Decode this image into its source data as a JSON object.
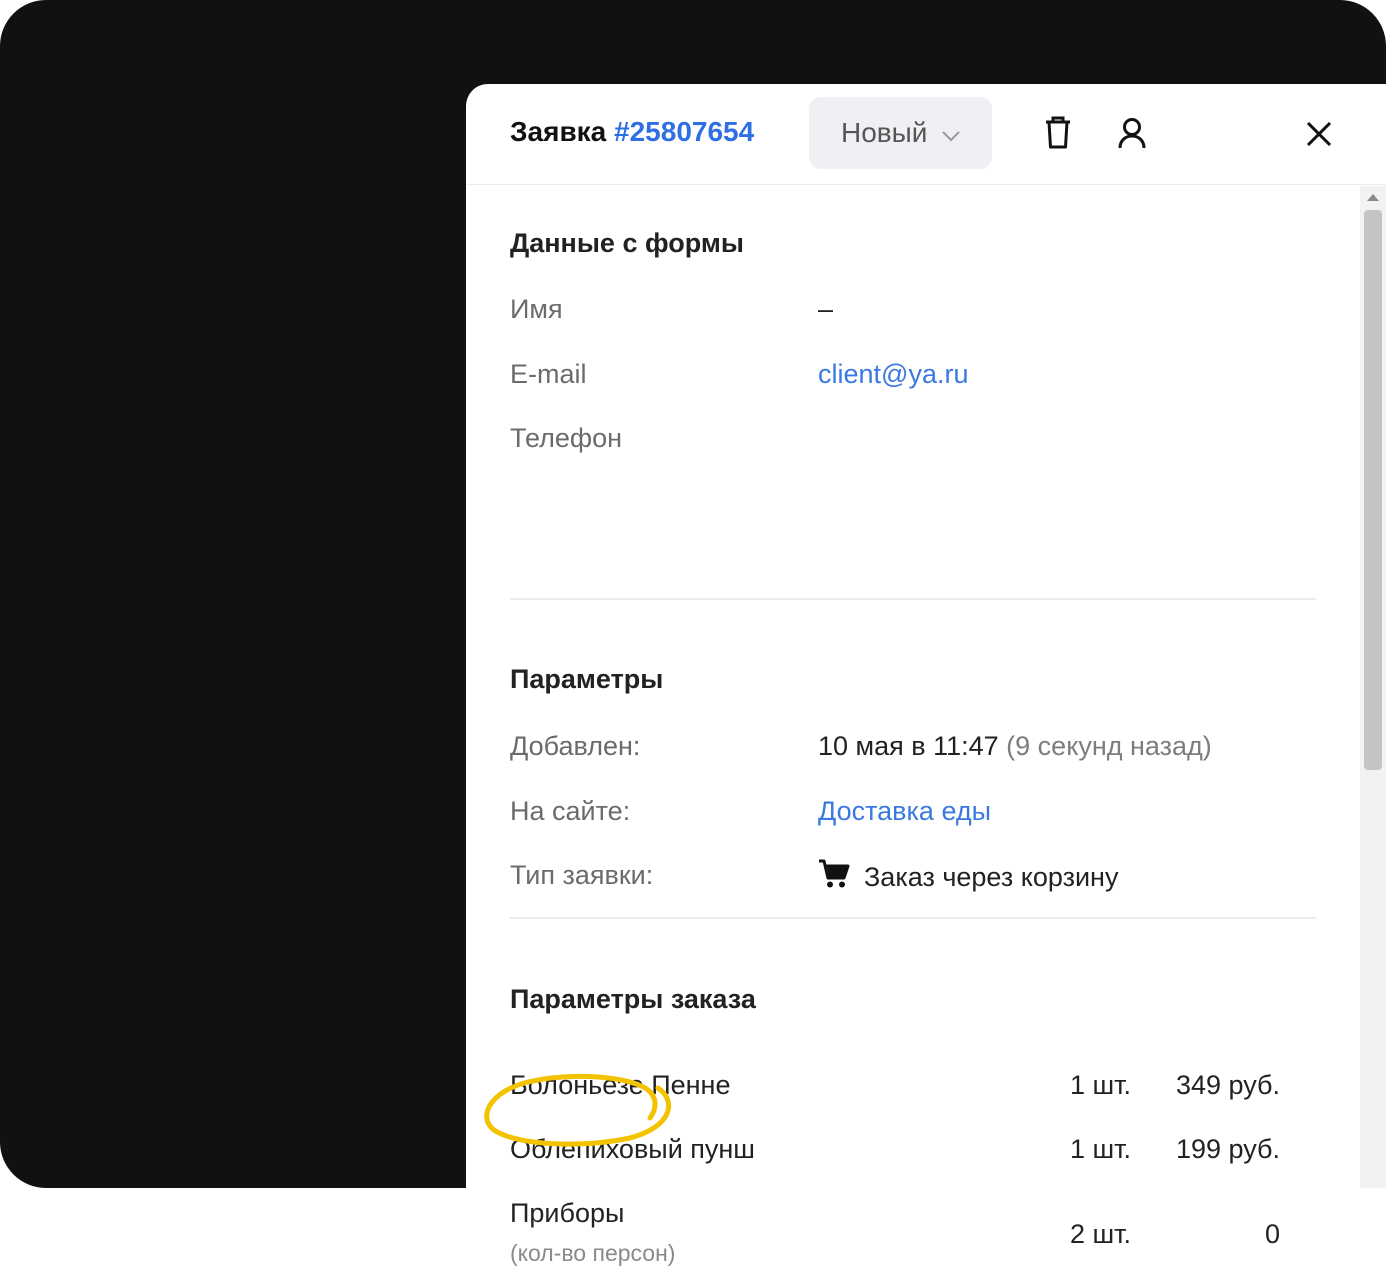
{
  "header": {
    "title_prefix": "Заявка",
    "order_number": "#25807654",
    "status": "Новый",
    "accent_color": "#2f6fe4"
  },
  "icons": {
    "status_dropdown": "chevron-down-icon",
    "delete": "trash-icon",
    "assign": "user-icon",
    "close": "close-icon",
    "order_type": "cart-icon"
  },
  "form_data": {
    "title": "Данные с формы",
    "fields": [
      {
        "label": "Имя",
        "value": "–"
      },
      {
        "label": "E-mail",
        "value": "client@ya.ru"
      },
      {
        "label": "Телефон",
        "value": ""
      }
    ]
  },
  "parameters": {
    "title": "Параметры",
    "added_label": "Добавлен:",
    "added_value": "10 мая в 11:47",
    "added_ago": "(9 секунд назад)",
    "site_label": "На сайте:",
    "site_value": "Доставка еды",
    "type_label": "Тип заявки:",
    "type_value": "Заказ через корзину"
  },
  "order_params": {
    "title": "Параметры заказа",
    "items": [
      {
        "name": "Болоньезе Пенне",
        "qty": "1 шт.",
        "price": "349 руб."
      },
      {
        "name": "Облепиховый пунш",
        "qty": "1 шт.",
        "price": "199 руб."
      },
      {
        "name": "Приборы",
        "sub": "(кол-во персон)",
        "qty": "2 шт.",
        "price": "0"
      }
    ]
  }
}
